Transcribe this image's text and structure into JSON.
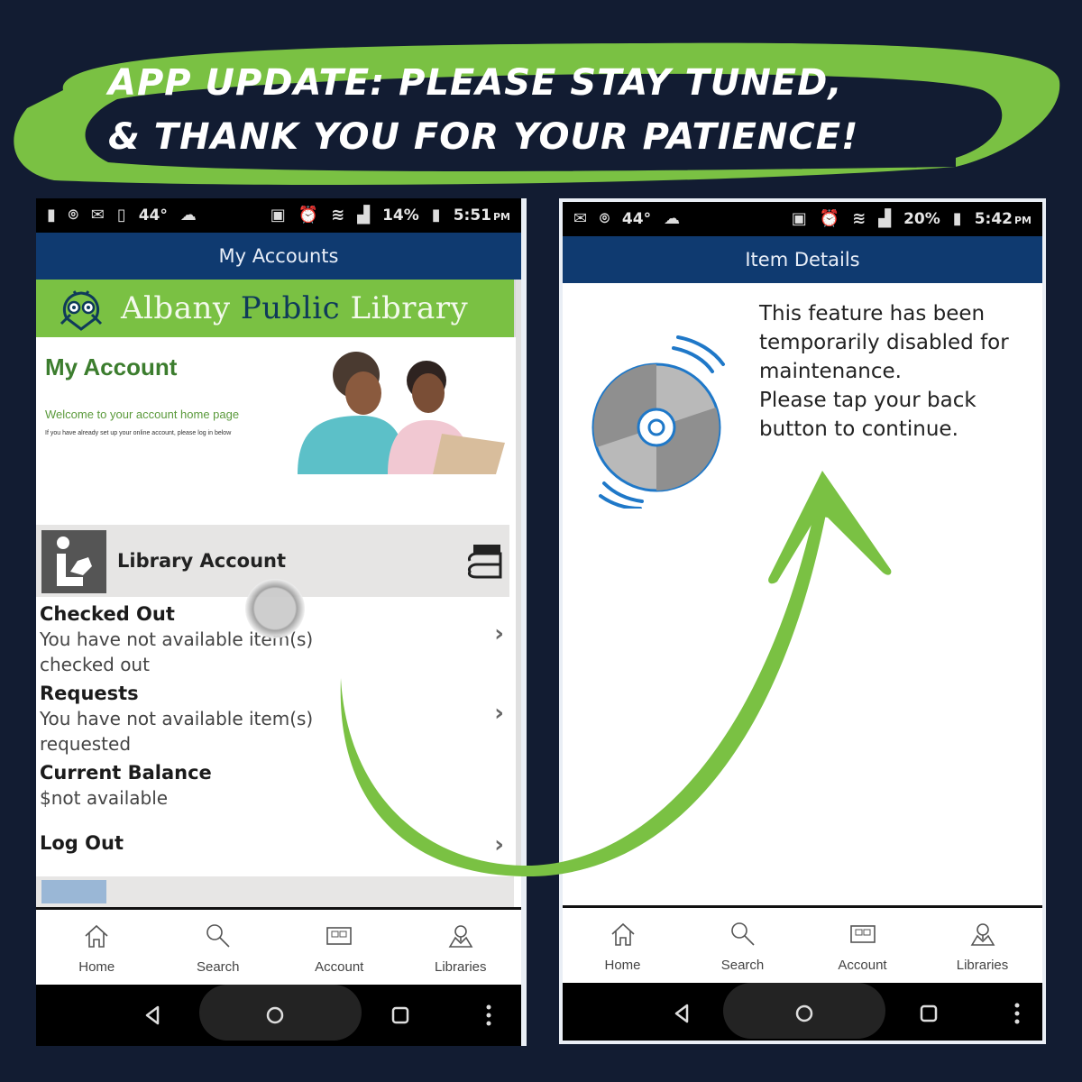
{
  "banner": {
    "line1": "App Update: Please Stay Tuned,",
    "line2": "& Thank You For Your Patience!"
  },
  "colors": {
    "background": "#121c32",
    "accent_green": "#7ac143",
    "app_blue": "#0f3a70",
    "disc_blue": "#1f78c8"
  },
  "left_phone": {
    "status": {
      "temp": "44°",
      "battery": "14%",
      "time": "5:51",
      "ampm": "PM"
    },
    "title": "My Accounts",
    "library": {
      "name_part1": "Albany",
      "name_part2": "Public",
      "name_part3": "Library"
    },
    "my_account": {
      "title": "My Account",
      "welcome": "Welcome to your account home page",
      "note": "If you have already set up your online account, please log in below"
    },
    "library_account": {
      "title": "Library Account"
    },
    "items": [
      {
        "heading": "Checked Out",
        "detail": "You have not available item(s) checked out",
        "chevron": "›"
      },
      {
        "heading": "Requests",
        "detail": "You have not available item(s) requested",
        "chevron": "›"
      },
      {
        "heading": "Current Balance",
        "detail": "$not available"
      },
      {
        "heading": "Log Out",
        "chevron": "›"
      }
    ],
    "tabs": [
      {
        "label": "Home",
        "icon": "home-icon"
      },
      {
        "label": "Search",
        "icon": "search-icon"
      },
      {
        "label": "Account",
        "icon": "account-card-icon"
      },
      {
        "label": "Libraries",
        "icon": "libraries-map-icon"
      }
    ]
  },
  "right_phone": {
    "status": {
      "temp": "44°",
      "battery": "20%",
      "time": "5:42",
      "ampm": "PM"
    },
    "title": "Item Details",
    "message": {
      "line1": "This feature has been temporarily disabled for maintenance.",
      "line2": "Please tap your back button to continue."
    },
    "tabs": [
      {
        "label": "Home",
        "icon": "home-icon"
      },
      {
        "label": "Search",
        "icon": "search-icon"
      },
      {
        "label": "Account",
        "icon": "account-card-icon"
      },
      {
        "label": "Libraries",
        "icon": "libraries-map-icon"
      }
    ]
  }
}
